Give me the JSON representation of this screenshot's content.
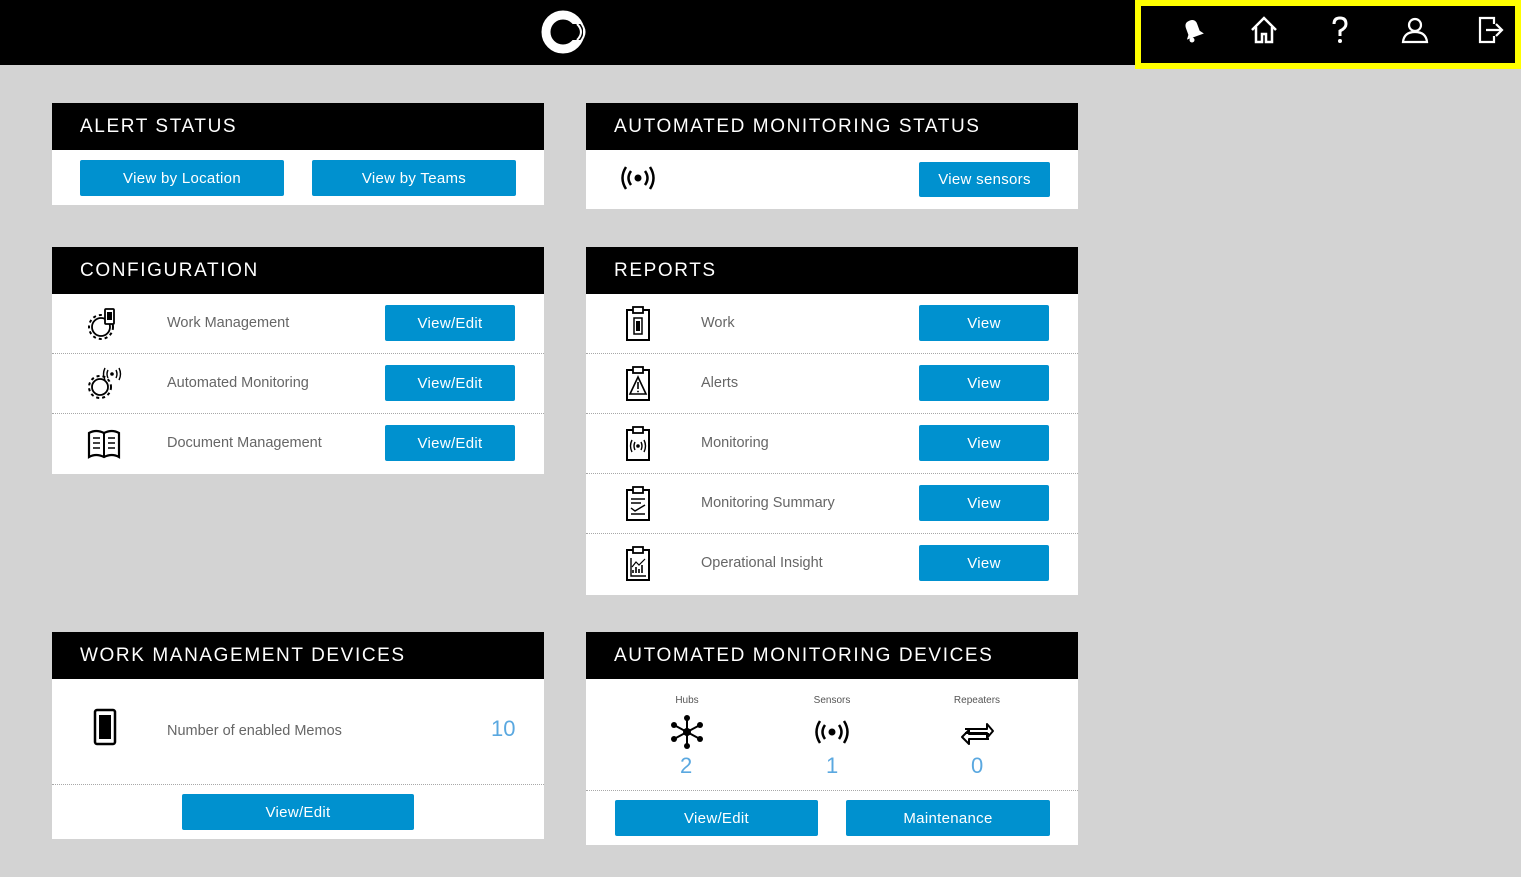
{
  "topbar": {
    "logo_icon": "circle-logo-icon",
    "nav_icons": [
      "bell-icon",
      "home-icon",
      "help-icon",
      "user-icon",
      "logout-icon"
    ],
    "highlight_color": "#ffff00"
  },
  "alert_status": {
    "title": "ALERT STATUS",
    "view_by_location": "View by Location",
    "view_by_teams": "View by Teams"
  },
  "automated_monitoring_status": {
    "title": "AUTOMATED MONITORING STATUS",
    "icon": "signal-icon",
    "view_sensors": "View sensors"
  },
  "configuration": {
    "title": "CONFIGURATION",
    "items": [
      {
        "label": "Work Management",
        "button": "View/Edit",
        "icon": "gear-phone-icon"
      },
      {
        "label": "Automated Monitoring",
        "button": "View/Edit",
        "icon": "gear-signal-icon"
      },
      {
        "label": "Document Management",
        "button": "View/Edit",
        "icon": "book-icon"
      }
    ]
  },
  "reports": {
    "title": "REPORTS",
    "items": [
      {
        "label": "Work",
        "button": "View",
        "icon": "clipboard-phone-icon"
      },
      {
        "label": "Alerts",
        "button": "View",
        "icon": "clipboard-warning-icon"
      },
      {
        "label": "Monitoring",
        "button": "View",
        "icon": "clipboard-signal-icon"
      },
      {
        "label": "Monitoring Summary",
        "button": "View",
        "icon": "clipboard-list-icon"
      },
      {
        "label": "Operational Insight",
        "button": "View",
        "icon": "clipboard-chart-icon"
      }
    ]
  },
  "work_management_devices": {
    "title": "WORK MANAGEMENT DEVICES",
    "label": "Number of enabled Memos",
    "count": "10",
    "button": "View/Edit",
    "icon": "phone-icon"
  },
  "automated_monitoring_devices": {
    "title": "AUTOMATED MONITORING DEVICES",
    "stats": [
      {
        "label": "Hubs",
        "value": "2",
        "icon": "hub-icon"
      },
      {
        "label": "Sensors",
        "value": "1",
        "icon": "signal-icon"
      },
      {
        "label": "Repeaters",
        "value": "0",
        "icon": "repeater-icon"
      }
    ],
    "view_edit": "View/Edit",
    "maintenance": "Maintenance"
  },
  "colors": {
    "button": "#0091cf",
    "count": "#5aa8e0",
    "background": "#d3d3d3"
  }
}
